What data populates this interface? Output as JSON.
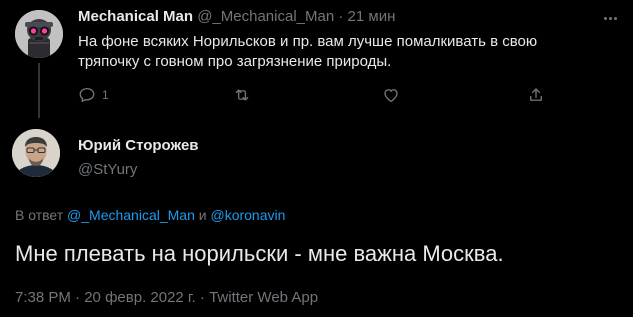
{
  "colors": {
    "background": "#000000",
    "text": "#e7e9ea",
    "muted": "#71767b",
    "link": "#1d9bf0"
  },
  "parent_tweet": {
    "author_name": "Mechanical Man",
    "handle": "@_Mechanical_Man",
    "separator": "·",
    "time": "21 мин",
    "text": "На фоне всяких Норильсков и пр. вам лучше помалкивать в свою тряпочку с говном про загрязнение природы.",
    "actions": {
      "reply_icon": "reply-icon",
      "reply_count": "1",
      "retweet_icon": "retweet-icon",
      "like_icon": "heart-icon",
      "share_icon": "share-icon"
    },
    "more_icon": "more-options-icon"
  },
  "tweet": {
    "author_name": "Юрий Сторожев",
    "handle": "@StYury",
    "reply_prefix": "В ответ",
    "reply_user_1": "@_Mechanical_Man",
    "reply_conj": "и",
    "reply_user_2": "@koronavin",
    "text": "Мне плевать на норильски - мне важна Москва.",
    "time": "7:38 PM",
    "separator": "·",
    "date": "20 февр. 2022 г.",
    "source": "Twitter Web App"
  }
}
